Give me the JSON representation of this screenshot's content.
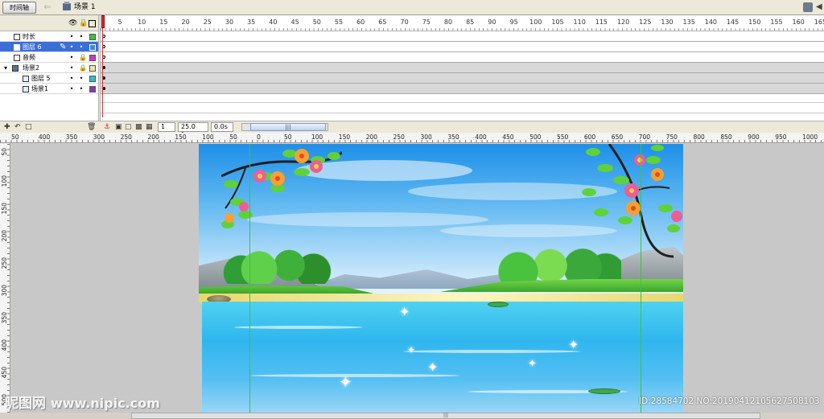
{
  "topbar": {
    "timeline_button": "时间轴",
    "scene_label": "场景 1"
  },
  "layers": {
    "header_icons": [
      "eye-icon",
      "lock-icon",
      "outline-icon"
    ],
    "items": [
      {
        "name": "时长",
        "color": "#3fbf3f",
        "selected": false
      },
      {
        "name": "图层 6",
        "color": "#3a8ad8",
        "selected": true
      },
      {
        "name": "音频",
        "color": "#c040c0",
        "selected": false
      },
      {
        "name": "场景2",
        "color": "#e8e8a0",
        "selected": false
      },
      {
        "name": "图层 5",
        "color": "#30c0c0",
        "selected": false
      },
      {
        "name": "场景1",
        "color": "#8040a0",
        "selected": false
      }
    ]
  },
  "frame_ruler": [
    "5",
    "10",
    "15",
    "20",
    "25",
    "30",
    "35",
    "40",
    "45",
    "50",
    "55",
    "60",
    "65",
    "70",
    "75",
    "80",
    "85",
    "90",
    "95",
    "100",
    "105",
    "110",
    "115",
    "120",
    "125",
    "130",
    "135",
    "140",
    "145",
    "150",
    "155",
    "160",
    "165"
  ],
  "timeline_footer": {
    "current_frame": "1",
    "frame_rate": "25.0 fps",
    "elapsed_time": "0.0s"
  },
  "stage_ruler_h": [
    "50",
    "400",
    "350",
    "300",
    "250",
    "200",
    "150",
    "100",
    "50",
    "0",
    "50",
    "100",
    "150",
    "200",
    "250",
    "300",
    "350",
    "400",
    "450",
    "500",
    "550",
    "600",
    "650",
    "700",
    "750",
    "800",
    "850",
    "900",
    "950",
    "1000"
  ],
  "stage_ruler_v": [
    "50",
    "100",
    "150",
    "200",
    "250",
    "300",
    "350",
    "400",
    "450",
    "500"
  ],
  "watermark": {
    "site_name": "昵图网",
    "url": "www.nipic.com",
    "id_text": "ID:28584702 NO:20190412105627508103"
  },
  "colors": {
    "selected_layer": "#3a6fd8",
    "playhead": "#d83030",
    "sky_top": "#1e8fe8",
    "water": "#2fb6ee"
  }
}
